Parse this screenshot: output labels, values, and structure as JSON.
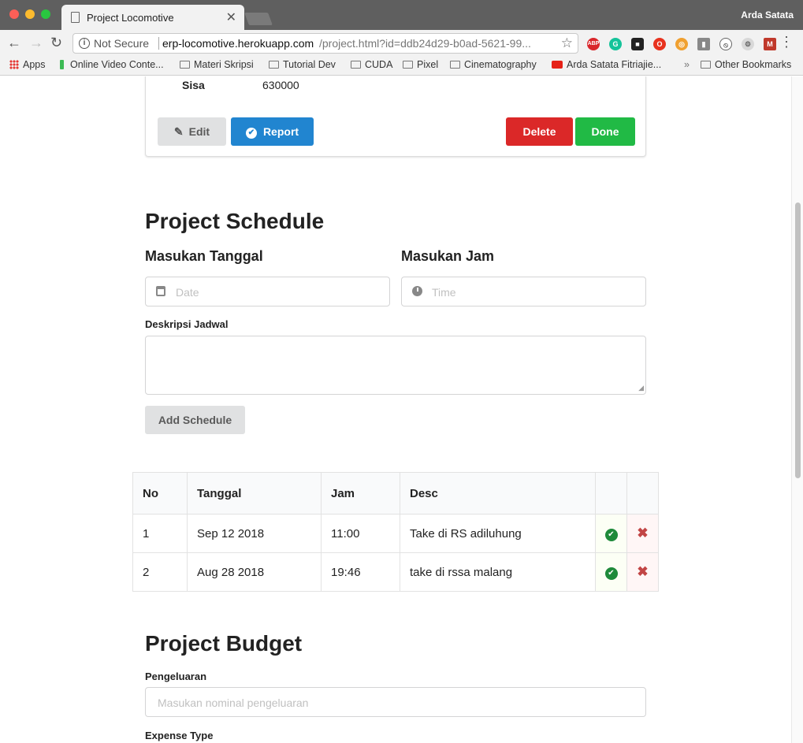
{
  "browser": {
    "tab_title": "Project Locomotive",
    "profile_name": "Arda Satata",
    "url_security": "Not Secure",
    "url_domain": "erp-locomotive.herokuapp.com",
    "url_path": "/project.html?id=ddb24d29-b0ad-5621-99...",
    "extensions": [
      "ABP",
      "G",
      "■",
      "O",
      "◎",
      "▮",
      "⦸",
      "⚙",
      "M"
    ],
    "bookmarks": [
      "Apps",
      "Online Video Conte...",
      "Materi Skripsi",
      "Tutorial Dev",
      "CUDA",
      "Pixel",
      "Cinematography",
      "Arda Satata Fitriajie...",
      "»",
      "Other Bookmarks"
    ]
  },
  "project_card": {
    "sisa_label": "Sisa",
    "sisa_value": "630000",
    "edit_label": "Edit",
    "report_label": "Report",
    "delete_label": "Delete",
    "done_label": "Done"
  },
  "schedule": {
    "title": "Project Schedule",
    "date_heading": "Masukan Tanggal",
    "time_heading": "Masukan Jam",
    "date_placeholder": "Date",
    "time_placeholder": "Time",
    "desc_label": "Deskripsi Jadwal",
    "add_button": "Add Schedule",
    "table": {
      "headers": [
        "No",
        "Tanggal",
        "Jam",
        "Desc",
        "",
        ""
      ],
      "rows": [
        {
          "no": "1",
          "tanggal": "Sep 12 2018",
          "jam": "11:00",
          "desc": "Take di RS adiluhung"
        },
        {
          "no": "2",
          "tanggal": "Aug 28 2018",
          "jam": "19:46",
          "desc": "take di rssa malang"
        }
      ]
    }
  },
  "budget": {
    "title": "Project Budget",
    "pengeluaran_label": "Pengeluaran",
    "pengeluaran_placeholder": "Masukan nominal pengeluaran",
    "expense_type_label": "Expense Type"
  },
  "colors": {
    "report": "#2185d0",
    "delete": "#db2828",
    "done": "#21ba45"
  }
}
